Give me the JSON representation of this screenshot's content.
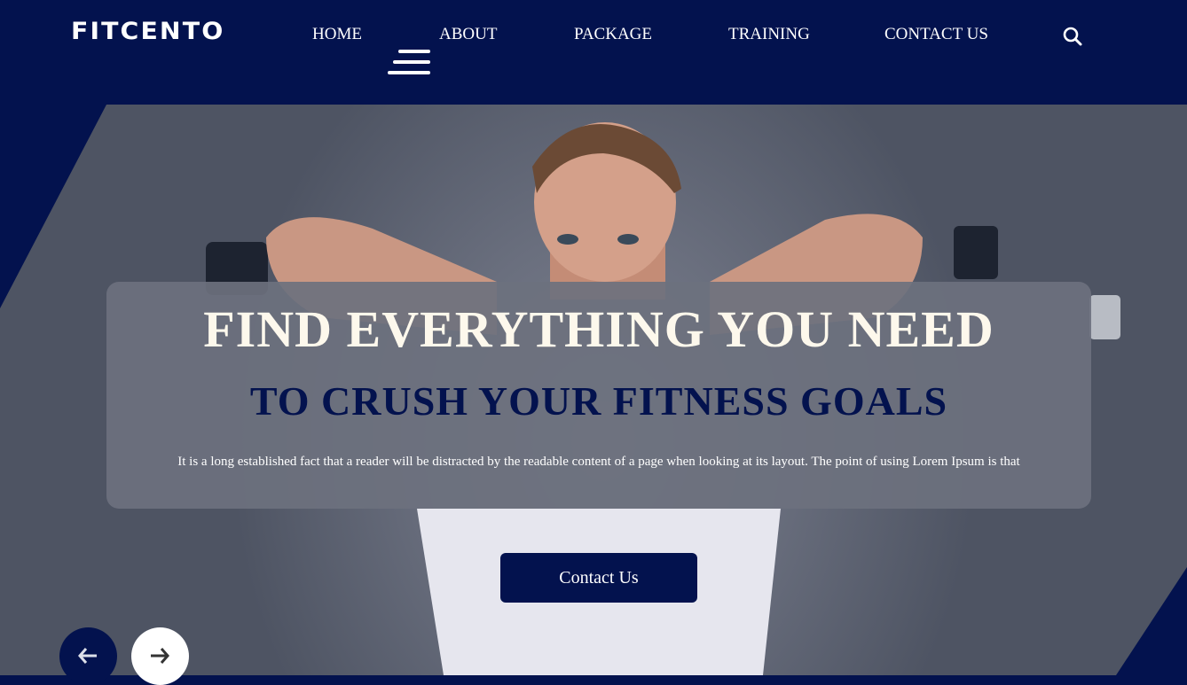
{
  "brand": {
    "logo": "FITCENTO"
  },
  "nav": {
    "items": [
      {
        "label": "HOME"
      },
      {
        "label": "ABOUT"
      },
      {
        "label": "PACKAGE"
      },
      {
        "label": "TRAINING"
      },
      {
        "label": "CONTACT US"
      }
    ],
    "search_icon": "search-icon",
    "menu_icon": "hamburger-menu-icon"
  },
  "hero": {
    "title": "FIND EVERYTHING YOU NEED",
    "subtitle": "TO CRUSH YOUR FITNESS GOALS",
    "text": "It is a long established fact that a reader will be distracted by the readable content of a page when looking at its layout. The point of using Lorem Ipsum is that",
    "cta_label": "Contact Us",
    "prev_icon": "arrow-left-icon",
    "next_icon": "arrow-right-icon"
  },
  "colors": {
    "primary": "#03124e",
    "title_text": "#fdf8ec",
    "banner_bg": "#6c717e"
  }
}
